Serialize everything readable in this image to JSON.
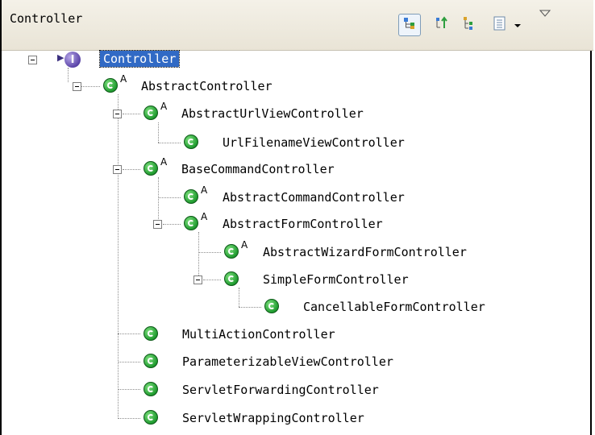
{
  "view": {
    "title": "Controller"
  },
  "toolbar": {
    "buttons": [
      {
        "name": "type-hierarchy-icon",
        "active": true
      },
      {
        "name": "supertype-hierarchy-icon",
        "active": false
      },
      {
        "name": "subtype-hierarchy-icon",
        "active": false
      },
      {
        "name": "history-list-icon",
        "active": false
      },
      {
        "name": "dropdown-arrow-icon",
        "active": false
      },
      {
        "name": "view-menu-icon",
        "active": false
      }
    ]
  },
  "tree": {
    "nodes": [
      {
        "label": "Controller",
        "kind": "interface",
        "abstract": false,
        "selected": true
      },
      {
        "label": "AbstractController",
        "kind": "class",
        "abstract": true
      },
      {
        "label": "AbstractUrlViewController",
        "kind": "class",
        "abstract": true
      },
      {
        "label": "UrlFilenameViewController",
        "kind": "class",
        "abstract": false
      },
      {
        "label": "BaseCommandController",
        "kind": "class",
        "abstract": true
      },
      {
        "label": "AbstractCommandController",
        "kind": "class",
        "abstract": true
      },
      {
        "label": "AbstractFormController",
        "kind": "class",
        "abstract": true
      },
      {
        "label": "AbstractWizardFormController",
        "kind": "class",
        "abstract": true
      },
      {
        "label": "SimpleFormController",
        "kind": "class",
        "abstract": false
      },
      {
        "label": "CancellableFormController",
        "kind": "class",
        "abstract": false
      },
      {
        "label": "MultiActionController",
        "kind": "class",
        "abstract": false
      },
      {
        "label": "ParameterizableViewController",
        "kind": "class",
        "abstract": false
      },
      {
        "label": "ServletForwardingController",
        "kind": "class",
        "abstract": false
      },
      {
        "label": "ServletWrappingController",
        "kind": "class",
        "abstract": false
      }
    ]
  },
  "colors": {
    "selection": "#316ac5",
    "class_green": "#1f9b2f",
    "interface_purple": "#5b44a8"
  }
}
